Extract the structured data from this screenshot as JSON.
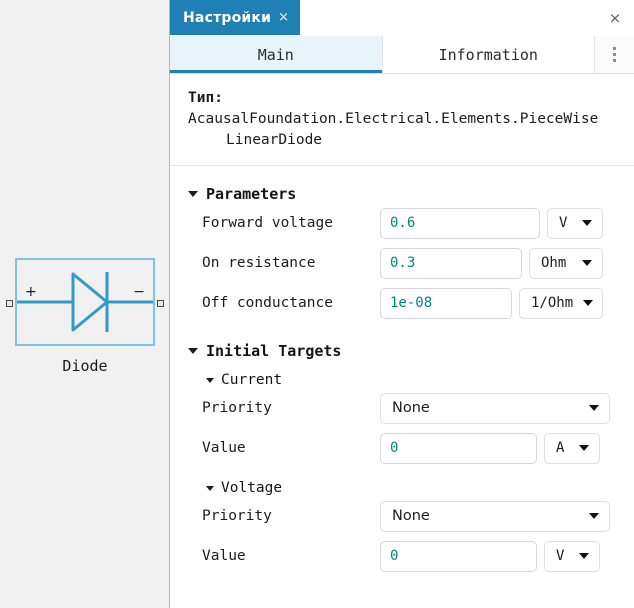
{
  "window": {
    "tab_title": "Настройки",
    "tab_close_glyph": "×",
    "close_glyph": "×"
  },
  "tabs": {
    "items": [
      {
        "label": "Main",
        "active": true
      },
      {
        "label": "Information",
        "active": false
      }
    ],
    "kebab_name": "more-options"
  },
  "type_info": {
    "key": "Тип:",
    "value_line1": "AcausalFoundation.Electrical.Elements.PieceWise",
    "value_line2": "LinearDiode",
    "full_value": "AcausalFoundation.Electrical.Elements.PieceWiseLinearDiode"
  },
  "canvas": {
    "component_label": "Diode",
    "port_plus": "+",
    "port_minus": "−",
    "symbol_color": "#3399cc",
    "selection_color": "#7ec1ea"
  },
  "parameters": {
    "title": "Parameters",
    "rows": [
      {
        "label": "Forward voltage",
        "value": "0.6",
        "unit": "V"
      },
      {
        "label": "On resistance",
        "value": "0.3",
        "unit": "Ohm"
      },
      {
        "label": "Off conductance",
        "value": "1e-08",
        "unit": "1/Ohm"
      }
    ]
  },
  "initial_targets": {
    "title": "Initial Targets",
    "groups": [
      {
        "name": "Current",
        "priority_label": "Priority",
        "priority_value": "None",
        "value_label": "Value",
        "value": "0",
        "unit": "A"
      },
      {
        "name": "Voltage",
        "priority_label": "Priority",
        "priority_value": "None",
        "value_label": "Value",
        "value": "0",
        "unit": "V"
      }
    ]
  },
  "colors": {
    "accent": "#1f80b5",
    "value_text": "#00897b",
    "panel_bg": "#f1f1f1",
    "active_tab_bg": "#e9f3fb"
  }
}
